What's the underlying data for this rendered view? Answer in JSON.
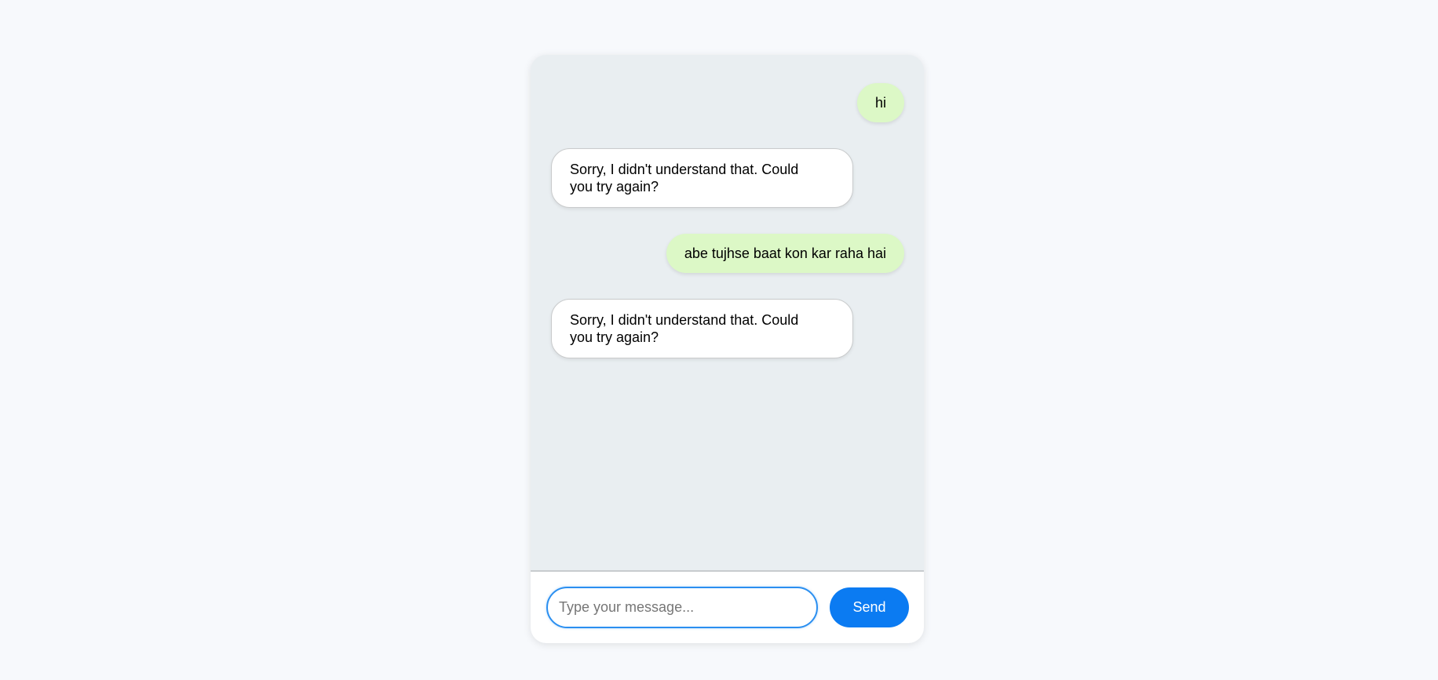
{
  "chat": {
    "messages": [
      {
        "sender": "user",
        "text": "hi"
      },
      {
        "sender": "bot",
        "text": "Sorry, I didn't understand that. Could you try again?"
      },
      {
        "sender": "user",
        "text": "abe tujhse baat kon kar raha hai"
      },
      {
        "sender": "bot",
        "text": "Sorry, I didn't understand that. Could you try again?"
      }
    ]
  },
  "composer": {
    "input_value": "",
    "placeholder": "Type your message...",
    "send_label": "Send"
  },
  "colors": {
    "page_background": "#f7f9fc",
    "chat_background": "#e9eef1",
    "user_bubble": "#dcf8c6",
    "bot_bubble": "#ffffff",
    "accent": "#0b7bf2"
  }
}
